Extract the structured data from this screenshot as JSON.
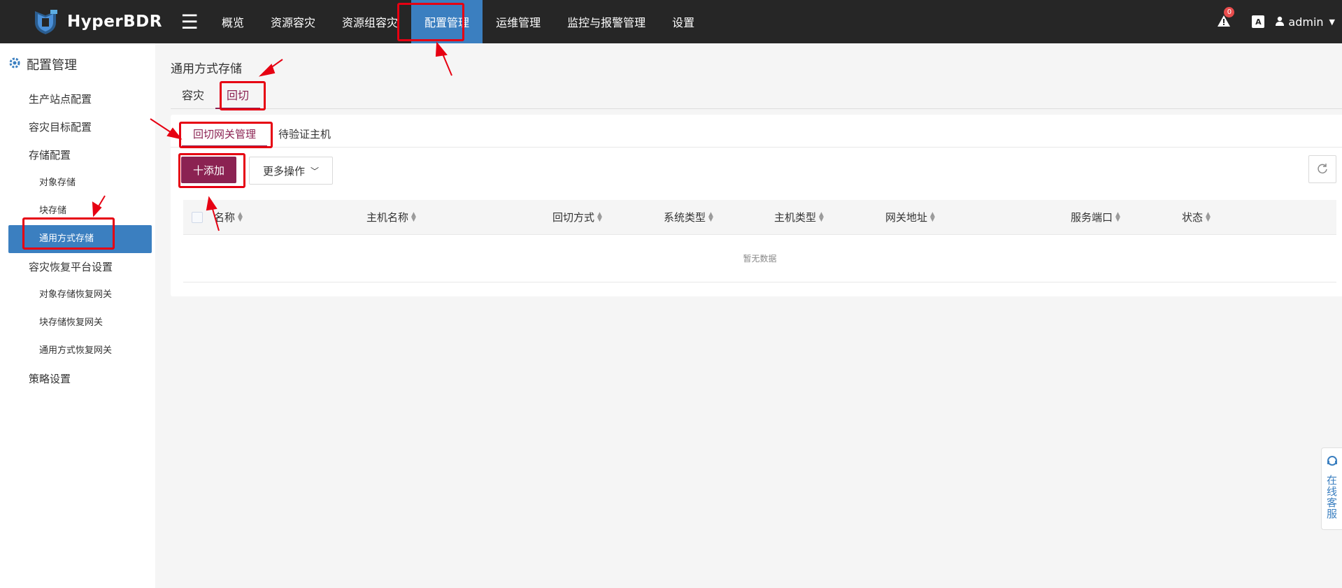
{
  "app": {
    "name": "HyperBDR",
    "menu_icon": "☰"
  },
  "nav": {
    "items": [
      {
        "label": "概览"
      },
      {
        "label": "资源容灾"
      },
      {
        "label": "资源组容灾"
      },
      {
        "label": "配置管理"
      },
      {
        "label": "运维管理"
      },
      {
        "label": "监控与报警管理"
      },
      {
        "label": "设置"
      }
    ],
    "active_index": 3,
    "alert_count": "0",
    "lang_icon_label": "A",
    "user": "admin"
  },
  "sidebar": {
    "title": "配置管理",
    "items": [
      {
        "label": "生产站点配置",
        "level": 1
      },
      {
        "label": "容灾目标配置",
        "level": 1
      },
      {
        "label": "存储配置",
        "level": 1
      },
      {
        "label": "对象存储",
        "level": 2
      },
      {
        "label": "块存储",
        "level": 2
      },
      {
        "label": "通用方式存储",
        "level": 2,
        "active": true
      },
      {
        "label": "容灾恢复平台设置",
        "level": 1
      },
      {
        "label": "对象存储恢复网关",
        "level": 2
      },
      {
        "label": "块存储恢复网关",
        "level": 2
      },
      {
        "label": "通用方式恢复网关",
        "level": 2
      },
      {
        "label": "策略设置",
        "level": 1
      }
    ]
  },
  "main": {
    "title": "通用方式存储",
    "tabs": [
      {
        "label": "容灾"
      },
      {
        "label": "回切",
        "active": true
      }
    ],
    "subtabs": [
      {
        "label": "回切网关管理",
        "active": true
      },
      {
        "label": "待验证主机"
      }
    ],
    "toolbar": {
      "add_label": "十添加",
      "more_label": "更多操作"
    },
    "table": {
      "columns": [
        "名称",
        "主机名称",
        "回切方式",
        "系统类型",
        "主机类型",
        "网关地址",
        "服务端口",
        "状态"
      ],
      "empty_text": "暂无数据"
    }
  },
  "service": {
    "label": "在线客服"
  },
  "colors": {
    "accent": "#8b2252",
    "nav_active": "#3b7fc0",
    "topbar": "#262626",
    "annotation": "#e60012"
  }
}
